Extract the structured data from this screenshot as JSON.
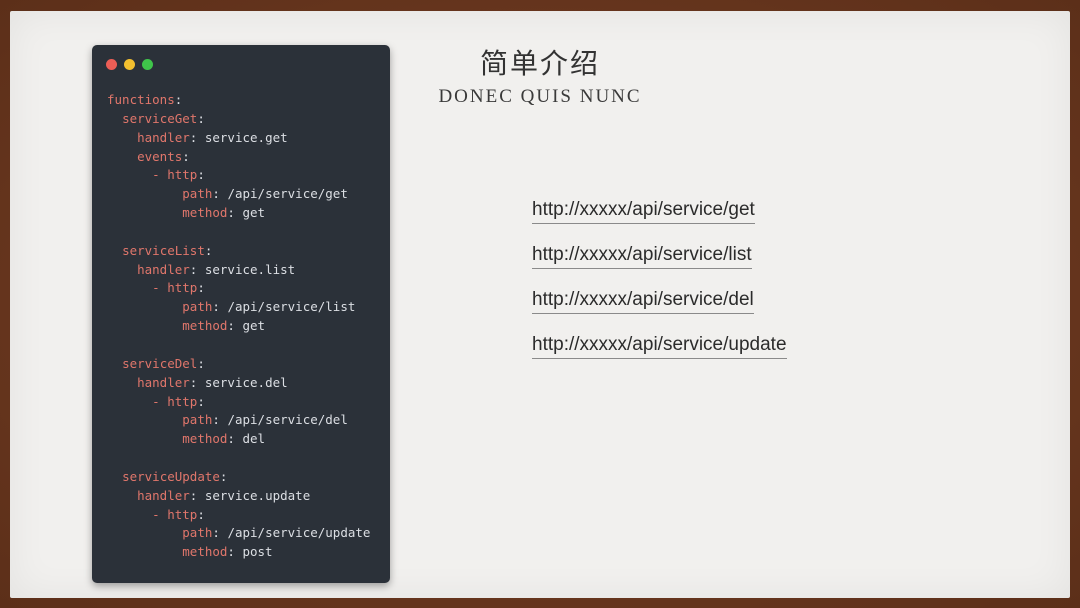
{
  "slide": {
    "title": "简单介绍",
    "subtitle": "DONEC QUIS NUNC",
    "links": [
      "http://xxxxx/api/service/get",
      "http://xxxxx/api/service/list",
      "http://xxxxx/api/service/del",
      "http://xxxxx/api/service/update"
    ]
  },
  "code": {
    "lines": [
      {
        "indent": "",
        "key": "functions",
        "sep": ":",
        "val": ""
      },
      {
        "indent": "  ",
        "key": "serviceGet",
        "sep": ":",
        "val": ""
      },
      {
        "indent": "    ",
        "key": "handler",
        "sep": ": ",
        "val": "service.get"
      },
      {
        "indent": "    ",
        "key": "events",
        "sep": ":",
        "val": ""
      },
      {
        "indent": "      ",
        "key": "- http",
        "sep": ":",
        "val": ""
      },
      {
        "indent": "          ",
        "key": "path",
        "sep": ": ",
        "val": "/api/service/get"
      },
      {
        "indent": "          ",
        "key": "method",
        "sep": ": ",
        "val": "get"
      },
      {
        "indent": "",
        "key": "",
        "sep": "",
        "val": ""
      },
      {
        "indent": "  ",
        "key": "serviceList",
        "sep": ":",
        "val": ""
      },
      {
        "indent": "    ",
        "key": "handler",
        "sep": ": ",
        "val": "service.list"
      },
      {
        "indent": "      ",
        "key": "- http",
        "sep": ":",
        "val": ""
      },
      {
        "indent": "          ",
        "key": "path",
        "sep": ": ",
        "val": "/api/service/list"
      },
      {
        "indent": "          ",
        "key": "method",
        "sep": ": ",
        "val": "get"
      },
      {
        "indent": "",
        "key": "",
        "sep": "",
        "val": ""
      },
      {
        "indent": "  ",
        "key": "serviceDel",
        "sep": ":",
        "val": ""
      },
      {
        "indent": "    ",
        "key": "handler",
        "sep": ": ",
        "val": "service.del"
      },
      {
        "indent": "      ",
        "key": "- http",
        "sep": ":",
        "val": ""
      },
      {
        "indent": "          ",
        "key": "path",
        "sep": ": ",
        "val": "/api/service/del"
      },
      {
        "indent": "          ",
        "key": "method",
        "sep": ": ",
        "val": "del"
      },
      {
        "indent": "",
        "key": "",
        "sep": "",
        "val": ""
      },
      {
        "indent": "  ",
        "key": "serviceUpdate",
        "sep": ":",
        "val": ""
      },
      {
        "indent": "    ",
        "key": "handler",
        "sep": ": ",
        "val": "service.update"
      },
      {
        "indent": "      ",
        "key": "- http",
        "sep": ":",
        "val": ""
      },
      {
        "indent": "          ",
        "key": "path",
        "sep": ": ",
        "val": "/api/service/update"
      },
      {
        "indent": "          ",
        "key": "method",
        "sep": ": ",
        "val": "post"
      }
    ]
  },
  "colors": {
    "frame": "#6b3a22",
    "slide_bg": "#f1f0ee",
    "code_bg": "#2b3139",
    "code_key": "#e0766b",
    "code_text": "#dcdfe4",
    "dot_red": "#ec5e56",
    "dot_yellow": "#f2bf2f",
    "dot_green": "#3fc54a"
  }
}
